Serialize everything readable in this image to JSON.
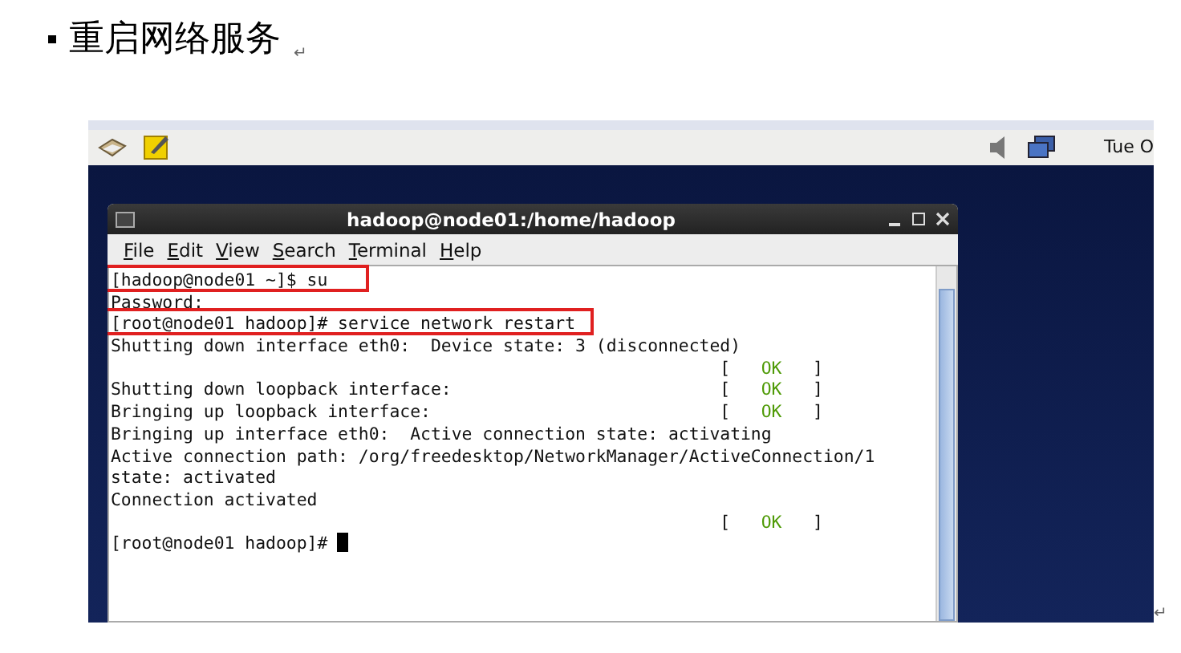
{
  "heading": {
    "text": "重启网络服务",
    "mark": "↵"
  },
  "screenshot": {
    "panel": {
      "clock": "Tue O"
    },
    "terminal": {
      "title": "hadoop@node01:/home/hadoop",
      "menu": [
        {
          "label": "File"
        },
        {
          "label": "Edit"
        },
        {
          "label": "View"
        },
        {
          "label": "Search"
        },
        {
          "label": "Terminal"
        },
        {
          "label": "Help"
        }
      ],
      "lines": [
        {
          "text": "[hadoop@node01 ~]$ su",
          "highlighted": true
        },
        {
          "text": "Password:",
          "highlighted": false
        },
        {
          "text": "[root@node01 hadoop]# service network restart",
          "highlighted": true
        },
        {
          "text": "Shutting down interface eth0:  Device state: 3 (disconnected)",
          "highlighted": false
        },
        {
          "highlighted": false,
          "status": {
            "left": "[",
            "word": "OK",
            "right": "]"
          }
        },
        {
          "text": "Shutting down loopback interface:",
          "highlighted": false,
          "status": {
            "left": "[",
            "word": "OK",
            "right": "]"
          }
        },
        {
          "text": "Bringing up loopback interface:",
          "highlighted": false,
          "status": {
            "left": "[",
            "word": "OK",
            "right": "]"
          }
        },
        {
          "text": "Bringing up interface eth0:  Active connection state: activating",
          "highlighted": false
        },
        {
          "text": "Active connection path: /org/freedesktop/NetworkManager/ActiveConnection/1",
          "highlighted": false
        },
        {
          "text": "state: activated",
          "highlighted": false
        },
        {
          "text": "Connection activated",
          "highlighted": false
        },
        {
          "highlighted": false,
          "status": {
            "left": "[",
            "word": "OK",
            "right": "]"
          }
        },
        {
          "text": "[root@node01 hadoop]#",
          "highlighted": false,
          "kind": "prompt"
        }
      ]
    }
  },
  "end_mark": "↵"
}
